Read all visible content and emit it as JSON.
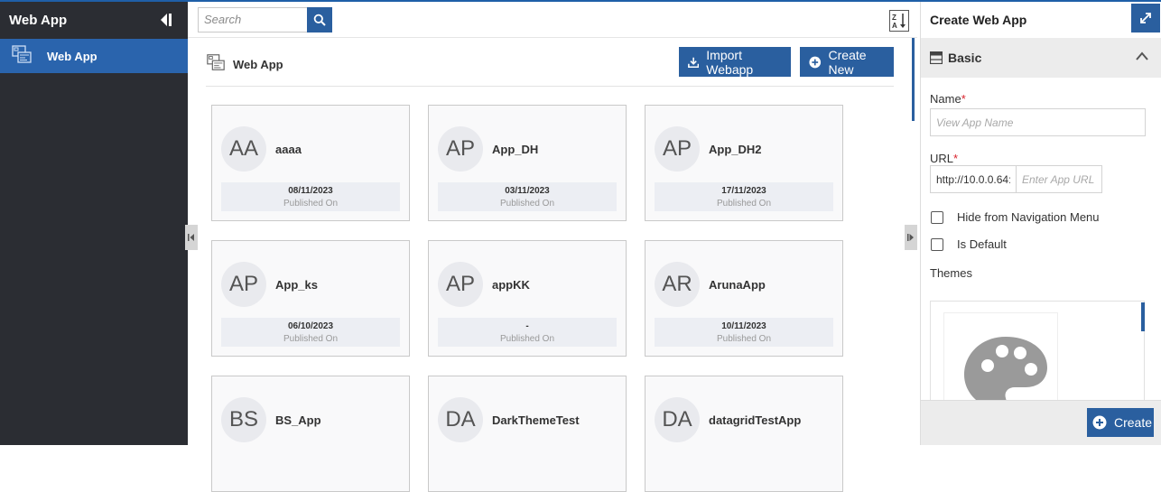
{
  "sidebar": {
    "title": "Web App",
    "items": [
      {
        "label": "Web App",
        "icon": "webapp-icon",
        "active": true
      }
    ]
  },
  "search": {
    "placeholder": "Search"
  },
  "breadcrumb": {
    "label": "Web App"
  },
  "actions": {
    "import_label": "Import Webapp",
    "create_new_label": "Create New"
  },
  "apps": [
    {
      "initials": "AA",
      "name": "aaaa",
      "date": "08/11/2023",
      "status": "Published On"
    },
    {
      "initials": "AP",
      "name": "App_DH",
      "date": "03/11/2023",
      "status": "Published On"
    },
    {
      "initials": "AP",
      "name": "App_DH2",
      "date": "17/11/2023",
      "status": "Published On"
    },
    {
      "initials": "AP",
      "name": "App_ks",
      "date": "06/10/2023",
      "status": "Published On"
    },
    {
      "initials": "AP",
      "name": "appKK",
      "date": "-",
      "status": "Published On"
    },
    {
      "initials": "AR",
      "name": "ArunaApp",
      "date": "10/11/2023",
      "status": "Published On"
    },
    {
      "initials": "BS",
      "name": "BS_App",
      "date": "",
      "status": ""
    },
    {
      "initials": "DA",
      "name": "DarkThemeTest",
      "date": "",
      "status": ""
    },
    {
      "initials": "DA",
      "name": "datagridTestApp",
      "date": "",
      "status": ""
    }
  ],
  "panel": {
    "title": "Create Web App",
    "section_label": "Basic",
    "name_label": "Name",
    "name_placeholder": "View App Name",
    "url_label": "URL",
    "url_prefix": "http://10.0.0.64:",
    "url_placeholder": "Enter App URL",
    "hide_nav_label": "Hide from Navigation Menu",
    "is_default_label": "Is Default",
    "themes_label": "Themes",
    "required_mark": "*",
    "create_label": "Create"
  },
  "colors": {
    "accent": "#2a5f9f",
    "sidebar_bg": "#2b2d33",
    "sidebar_active": "#2a64ad",
    "required": "#d9232d"
  }
}
